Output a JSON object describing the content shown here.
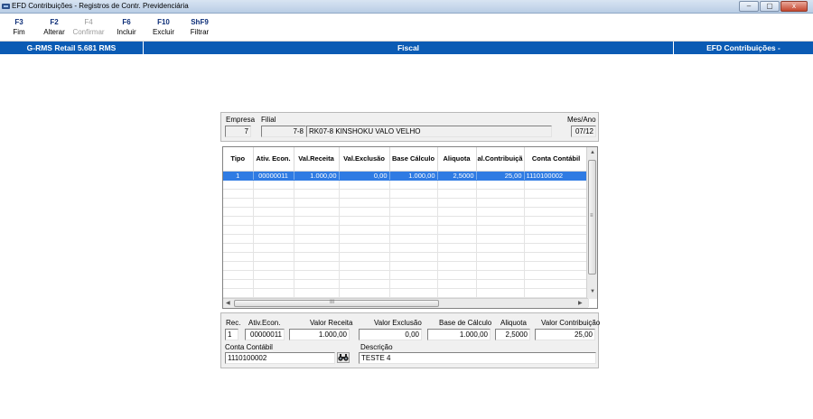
{
  "window": {
    "title": "EFD Contribuições - Registros de Contr. Previdenciária",
    "minimize": "–",
    "maximize": "▢",
    "close": "x"
  },
  "toolbar": [
    {
      "key": "F3",
      "label": "Fim",
      "enabled": true
    },
    {
      "key": "F2",
      "label": "Alterar",
      "enabled": true
    },
    {
      "key": "F4",
      "label": "Confirmar",
      "enabled": false
    },
    {
      "key": "F6",
      "label": "Incluir",
      "enabled": true
    },
    {
      "key": "F10",
      "label": "Excluir",
      "enabled": true
    },
    {
      "key": "ShF9",
      "label": "Filtrar",
      "enabled": true
    }
  ],
  "infobar": {
    "left": "G-RMS Retail 5.681 RMS",
    "center": "Fiscal",
    "right": "EFD Contribuições -"
  },
  "header": {
    "empresa_label": "Empresa",
    "empresa_value": "7",
    "filial_label": "Filial",
    "filial_code": "7-8",
    "filial_name": "RK07-8 KINSHOKU VALO VELHO",
    "mesano_label": "Mes/Ano",
    "mesano_value": "07/12"
  },
  "grid": {
    "columns": [
      "Tipo",
      "Ativ. Econ.",
      "Val.Receita",
      "Val.Exclusão",
      "Base Cálculo",
      "Aliquota",
      "al.Contribuiçã",
      "Conta Contábil"
    ],
    "rows": [
      [
        "1",
        "00000011",
        "1.000,00",
        "0,00",
        "1.000,00",
        "2,5000",
        "25,00",
        "1110100002"
      ]
    ],
    "empty_rows": 14,
    "hscroll_grip": "III",
    "vscroll_grip": "≡"
  },
  "detail": {
    "rec_label": "Rec.",
    "rec_value": "1",
    "ativ_label": "Ativ.Econ.",
    "ativ_value": "00000011",
    "receita_label": "Valor Receita",
    "receita_value": "1.000,00",
    "exclusao_label": "Valor Exclusão",
    "exclusao_value": "0,00",
    "base_label": "Base de Cálculo",
    "base_value": "1.000,00",
    "aliquota_label": "Aliquota",
    "aliquota_value": "2,5000",
    "contrib_label": "Valor Contribuição",
    "contrib_value": "25,00",
    "conta_label": "Conta Contábil",
    "conta_value": "1110100002",
    "descricao_label": "Descrição",
    "descricao_value": "TESTE 4"
  },
  "icons": {
    "lookup": "binoculars-icon"
  }
}
